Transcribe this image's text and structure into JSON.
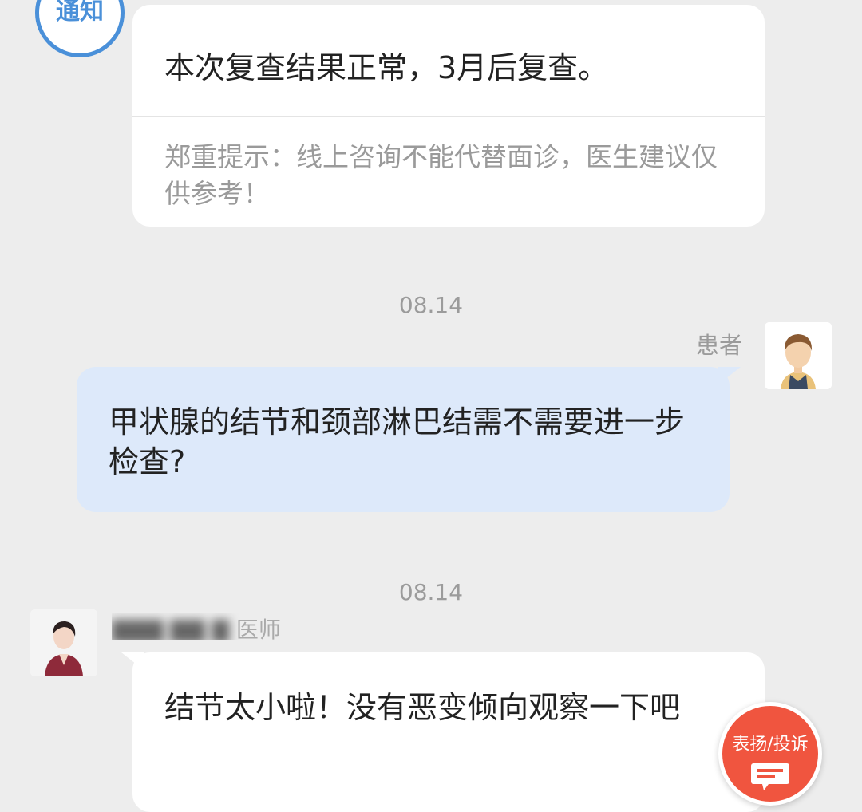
{
  "notice": {
    "badge": "通知",
    "message": "本次复查结果正常，3月后复查。",
    "disclaimer": "郑重提示：线上咨询不能代替面诊，医生建议仅供参考！"
  },
  "messages": [
    {
      "time": "08.14",
      "sender": "患者",
      "text": "甲状腺的结节和颈部淋巴结需不需要进一步检查?"
    },
    {
      "time": "08.14",
      "sender": "医师",
      "sender_blurred": "▇▇▇ ▇▇ ▇",
      "text": "结节太小啦！没有恶变倾向观察一下吧"
    }
  ],
  "feedback_button": {
    "label": "表扬/投诉"
  },
  "colors": {
    "background": "#ededed",
    "patient_bubble": "#dde9fa",
    "accent_blue": "#4a90d9",
    "feedback_red": "#f0553f"
  }
}
